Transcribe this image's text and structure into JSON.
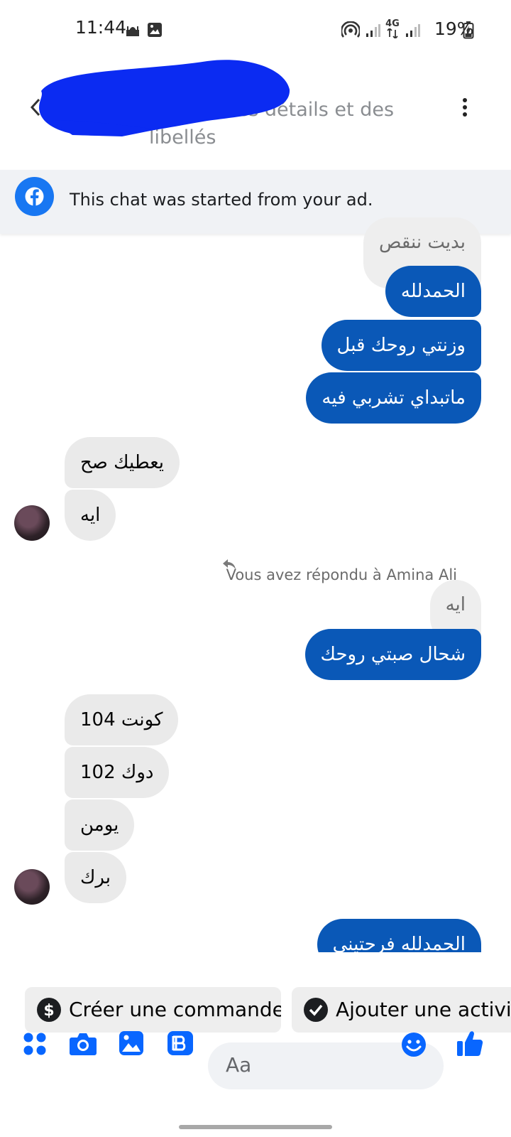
{
  "status_bar": {
    "time": "11:44",
    "battery": "19%",
    "network": "4G"
  },
  "header": {
    "title": "Ajouter des détails et des libellés"
  },
  "banner": {
    "text": "This chat was started from your ad."
  },
  "messages": {
    "partial_top": "بديت ننقص",
    "m1": "الحمدلله",
    "m2": "وزنتي روحك قبل",
    "m3": "ماتبداي تشربي فيه",
    "r1": "يعطيك صح",
    "r2": "ايه",
    "reply_note": "Vous avez répondu à Amina Ali",
    "quoted": "ايه",
    "m4": "شحال صبتي روحك",
    "r3": "كونت 104",
    "r4": "دوك 102",
    "r5": "يومن",
    "r6": "برك",
    "partial_bottom": "الحمدلله فرحتيني"
  },
  "quick_actions": {
    "create_order": "Créer une commande",
    "add_activity": "Ajouter une activi"
  },
  "composer": {
    "placeholder": "Aa"
  },
  "colors": {
    "accent": "#0866FF",
    "outgoing_bubble": "#0A58B7",
    "incoming_bubble": "#EAEAEA"
  }
}
